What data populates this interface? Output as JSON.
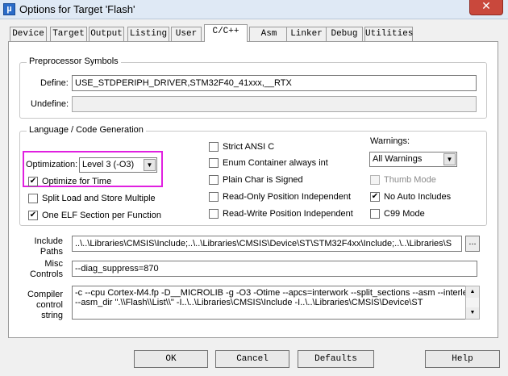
{
  "window": {
    "title": "Options for Target 'Flash'",
    "app_icon": "µ",
    "close_glyph": "✕"
  },
  "tabs": [
    "Device",
    "Target",
    "Output",
    "Listing",
    "User",
    "C/C++",
    "Asm",
    "Linker",
    "Debug",
    "Utilities"
  ],
  "active_tab": "C/C++",
  "preprocessor": {
    "group_title": "Preprocessor Symbols",
    "define_label": "Define:",
    "define_value": "USE_STDPERIPH_DRIVER,STM32F40_41xxx,__RTX",
    "undefine_label": "Undefine:",
    "undefine_value": ""
  },
  "language": {
    "group_title": "Language / Code Generation",
    "optimization_label": "Optimization:",
    "optimization_value": "Level 3 (-O3)",
    "optimize_for_time": {
      "label": "Optimize for Time",
      "checked": true
    },
    "split_load": {
      "label": "Split Load and Store Multiple",
      "checked": false
    },
    "one_elf": {
      "label": "One ELF Section per Function",
      "checked": true
    },
    "strict_ansi": {
      "label": "Strict ANSI C",
      "checked": false
    },
    "enum_container": {
      "label": "Enum Container always int",
      "checked": false
    },
    "plain_char": {
      "label": "Plain Char is Signed",
      "checked": false
    },
    "ropi": {
      "label": "Read-Only Position Independent",
      "checked": false
    },
    "rwpi": {
      "label": "Read-Write Position Independent",
      "checked": false
    },
    "warnings_label": "Warnings:",
    "warnings_value": "All Warnings",
    "thumb_mode": {
      "label": "Thumb Mode",
      "checked": false,
      "disabled": true
    },
    "no_auto_includes": {
      "label": "No Auto Includes",
      "checked": true
    },
    "c99": {
      "label": "C99 Mode",
      "checked": false
    }
  },
  "include": {
    "label_line1": "Include",
    "label_line2": "Paths",
    "value": "..\\..\\Libraries\\CMSIS\\Include;..\\..\\Libraries\\CMSIS\\Device\\ST\\STM32F4xx\\Include;..\\..\\Libraries\\S",
    "browse_label": "..."
  },
  "misc": {
    "label_line1": "Misc",
    "label_line2": "Controls",
    "value": "--diag_suppress=870"
  },
  "compiler": {
    "label_line1": "Compiler",
    "label_line2": "control",
    "label_line3": "string",
    "value": "-c --cpu Cortex-M4.fp -D__MICROLIB -g -O3 -Otime --apcs=interwork --split_sections --asm --interleave\n--asm_dir \".\\\\Flash\\\\List\\\\\" -I..\\..\\Libraries\\CMSIS\\Include -I..\\..\\Libraries\\CMSIS\\Device\\ST"
  },
  "buttons": {
    "ok": "OK",
    "cancel": "Cancel",
    "defaults": "Defaults",
    "help": "Help"
  },
  "icons": {
    "check": "✔",
    "dropdown": "▼",
    "scroll_up": "▲",
    "scroll_down": "▼"
  },
  "colors": {
    "highlight": "#e020e0",
    "close": "#c9483c"
  }
}
